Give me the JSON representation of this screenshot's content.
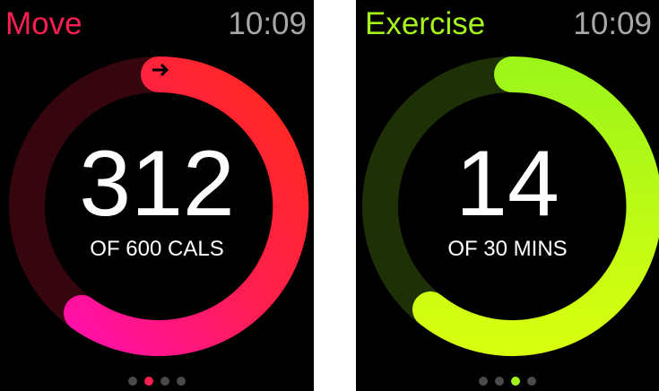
{
  "screens": [
    {
      "app_title": "Move",
      "time": "10:09",
      "value": "312",
      "goal_text": "OF 600 CALS",
      "accent_color": "#fa1f52",
      "ring_progress": 0.52,
      "pages": {
        "count": 4,
        "active": 2
      }
    },
    {
      "app_title": "Exercise",
      "time": "10:09",
      "value": "14",
      "goal_text": "OF 30 MINS",
      "accent_color": "#a6f31a",
      "ring_progress": 0.47,
      "pages": {
        "count": 4,
        "active": 3
      }
    }
  ]
}
